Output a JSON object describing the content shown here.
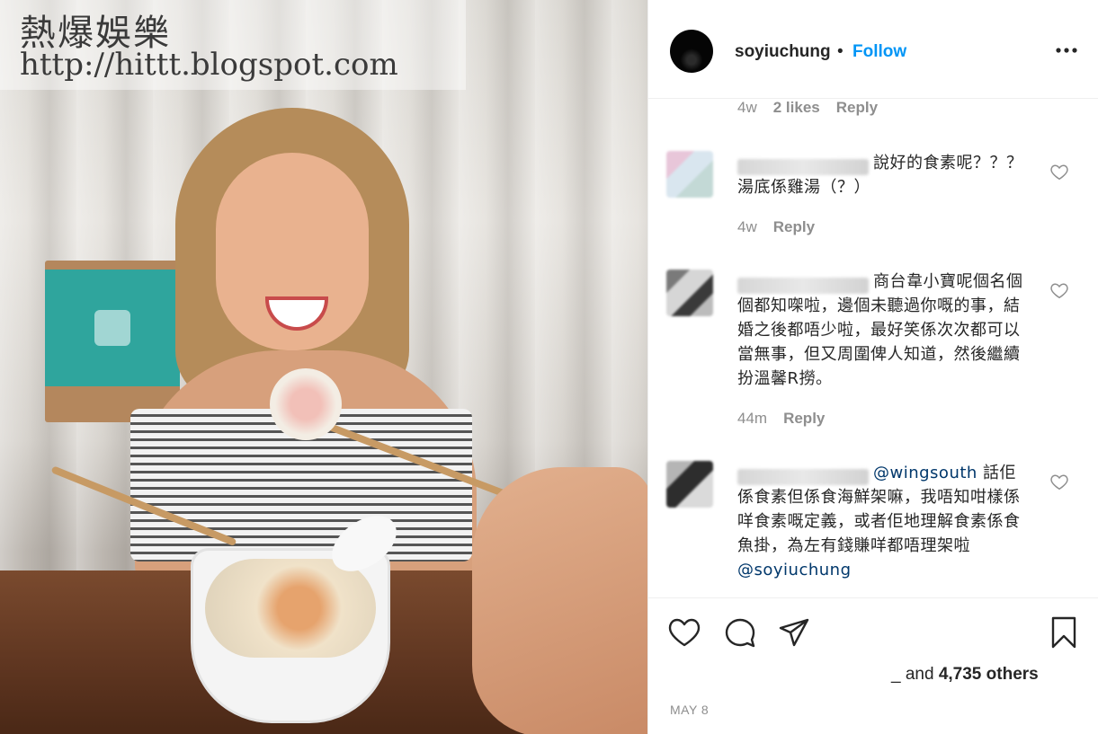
{
  "watermark": {
    "title": "熱爆娛樂",
    "url": "http://hittt.blogspot.com"
  },
  "post": {
    "username": "soyiuchung",
    "separator": "•",
    "follow_label": "Follow",
    "more_icon": "more-horizontal-icon"
  },
  "comments": {
    "previous_meta": {
      "time": "4w",
      "likes": "2 likes",
      "reply": "Reply"
    },
    "items": [
      {
        "text": "說好的食素呢？？？湯底係雞湯（？）",
        "time": "4w",
        "reply": "Reply"
      },
      {
        "text": "商台韋小寶呢個名個個都知㗎啦，邊個未聽過你嘅的事，結婚之後都唔少啦，最好笑係次次都可以當無事，但又周圍俾人知道，然後繼續扮溫馨R撈。",
        "time": "44m",
        "reply": "Reply"
      },
      {
        "mention_start": "@wingsouth",
        "text": " 話佢係食素但係食海鮮架嘛，我唔知咁樣係咩食素嘅定義，或者佢地理解食素係食魚掛，為左有錢賺咩都唔理架啦 ",
        "mention_end": "@soyiuchung"
      }
    ]
  },
  "actions": {
    "like_icon": "heart-icon",
    "comment_icon": "comment-icon",
    "share_icon": "paper-plane-icon",
    "save_icon": "bookmark-icon",
    "liked_prefix": "_ and ",
    "liked_count": "4,735 others",
    "date": "MAY 8"
  },
  "colors": {
    "accent": "#0095f6",
    "mention": "#00376b",
    "muted": "#8e8e8e",
    "text": "#262626",
    "divider": "#efefef"
  }
}
